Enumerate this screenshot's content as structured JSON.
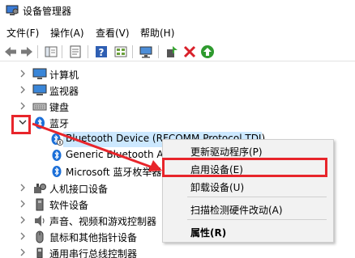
{
  "window": {
    "title": "设备管理器"
  },
  "menu": [
    "文件(F)",
    "操作(A)",
    "查看(V)",
    "帮助(H)"
  ],
  "tree": {
    "categories": {
      "computer": "计算机",
      "monitor": "监视器",
      "keyboard": "键盘",
      "bluetooth": "蓝牙",
      "hid": "人机接口设备",
      "software": "软件设备",
      "sound": "声音、视频和游戏控制器",
      "mouse": "鼠标和其他指针设备",
      "usb": "通用串行总线控制器"
    },
    "bluetooth_children": [
      "Bluetooth Device (RFCOMM Protocol TDI)",
      "Generic Bluetooth Adapter",
      "Microsoft 蓝牙枚举器"
    ]
  },
  "context_menu": {
    "update_driver": "更新驱动程序(P)",
    "enable_device": "启用设备(E)",
    "uninstall_device": "卸载设备(U)",
    "scan_hardware": "扫描检测硬件改动(A)",
    "properties": "属性(R)"
  },
  "colors": {
    "highlight_red": "#e8252b",
    "selection": "#cce8ff",
    "bluetooth_blue": "#1b6fd8"
  }
}
